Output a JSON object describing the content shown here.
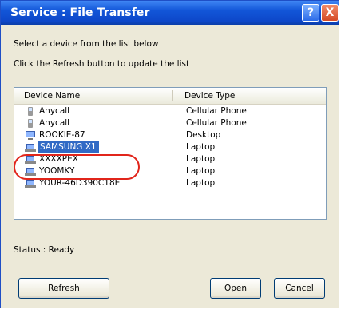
{
  "window": {
    "title": "Service : File Transfer",
    "help_label": "?",
    "close_label": "X"
  },
  "instructions": {
    "line1": "Select a device from the list below",
    "line2": "Click the Refresh button to update the list"
  },
  "list": {
    "columns": [
      "Device Name",
      "Device Type"
    ],
    "rows": [
      {
        "name": "Anycall",
        "type": "Cellular Phone",
        "icon": "phone-icon"
      },
      {
        "name": "Anycall",
        "type": "Cellular Phone",
        "icon": "phone-icon"
      },
      {
        "name": "ROOKIE-87",
        "type": "Desktop",
        "icon": "desktop-icon"
      },
      {
        "name": "SAMSUNG X1",
        "type": "Laptop",
        "icon": "laptop-icon",
        "selected": true
      },
      {
        "name": "XXXXPEX",
        "type": "Laptop",
        "icon": "laptop-icon"
      },
      {
        "name": "YOOMKY",
        "type": "Laptop",
        "icon": "laptop-icon"
      },
      {
        "name": "YOUR-46D390C18E",
        "type": "Laptop",
        "icon": "laptop-icon"
      }
    ]
  },
  "status": "Status : Ready",
  "buttons": {
    "refresh": "Refresh",
    "open": "Open",
    "cancel": "Cancel"
  },
  "colors": {
    "titlebar": "#0d47c9",
    "selection": "#316ac5",
    "annotation": "#e1251b"
  }
}
